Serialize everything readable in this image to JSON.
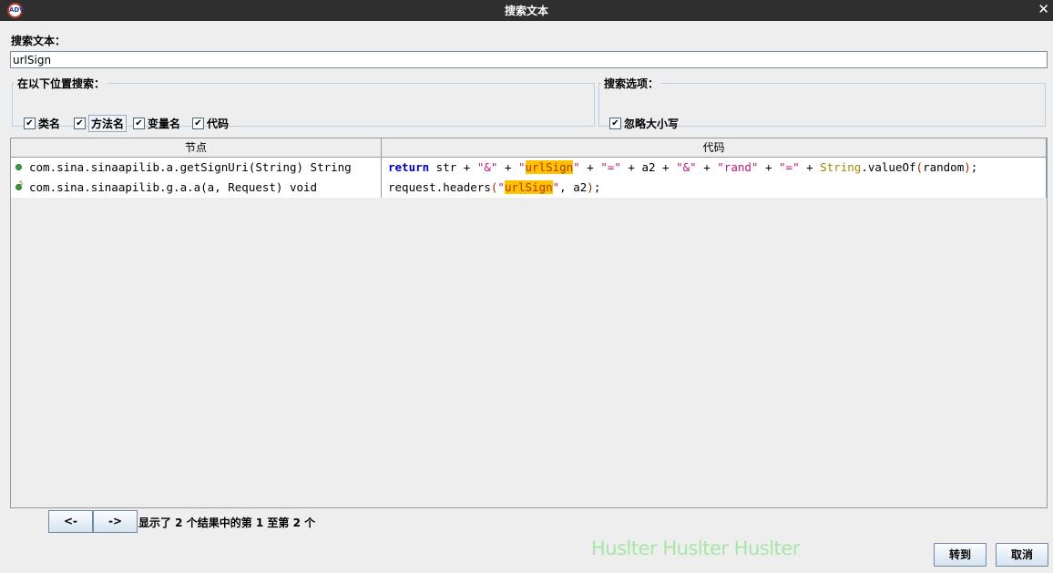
{
  "window": {
    "title": "搜索文本",
    "close_glyph": "✕",
    "icon_text": "ADV"
  },
  "search": {
    "label": "搜索文本：",
    "value": "urlSign"
  },
  "location_group": {
    "legend": "在以下位置搜索：",
    "options": [
      {
        "label": "类名",
        "checked": true
      },
      {
        "label": "方法名",
        "checked": true
      },
      {
        "label": "变量名",
        "checked": true
      },
      {
        "label": "代码",
        "checked": true
      }
    ]
  },
  "options_group": {
    "legend": "搜索选项：",
    "options": [
      {
        "label": "忽略大小写",
        "checked": true
      }
    ]
  },
  "results": {
    "columns": {
      "node": "节点",
      "code": "代码"
    },
    "rows": [
      {
        "node": "com.sina.sinaapilib.a.getSignUri(String) String",
        "icon": "method-public-icon",
        "code_tokens": [
          {
            "t": "return",
            "c": "kw"
          },
          {
            "t": " str + ",
            "c": ""
          },
          {
            "t": "\"&\"",
            "c": "str"
          },
          {
            "t": " + ",
            "c": ""
          },
          {
            "t": "\"",
            "c": "str"
          },
          {
            "t": "urlSign",
            "c": "hl"
          },
          {
            "t": "\"",
            "c": "str"
          },
          {
            "t": " + ",
            "c": ""
          },
          {
            "t": "\"=\"",
            "c": "str"
          },
          {
            "t": " + a2 + ",
            "c": ""
          },
          {
            "t": "\"&\"",
            "c": "str"
          },
          {
            "t": " + ",
            "c": ""
          },
          {
            "t": "\"rand\"",
            "c": "str"
          },
          {
            "t": " + ",
            "c": ""
          },
          {
            "t": "\"=\"",
            "c": "str"
          },
          {
            "t": " + ",
            "c": ""
          },
          {
            "t": "String",
            "c": "ty"
          },
          {
            "t": ".valueOf",
            "c": ""
          },
          {
            "t": "(",
            "c": "par"
          },
          {
            "t": "random",
            "c": ""
          },
          {
            "t": ")",
            "c": "par"
          },
          {
            "t": ";",
            "c": ""
          }
        ]
      },
      {
        "node": "com.sina.sinaapilib.g.a.a(a, Request) void",
        "icon": "method-static-icon",
        "code_tokens": [
          {
            "t": "request.headers",
            "c": ""
          },
          {
            "t": "(",
            "c": "par"
          },
          {
            "t": "\"",
            "c": "str"
          },
          {
            "t": "urlSign",
            "c": "hl"
          },
          {
            "t": "\"",
            "c": "str"
          },
          {
            "t": ", a2",
            "c": ""
          },
          {
            "t": ")",
            "c": "par"
          },
          {
            "t": ";",
            "c": ""
          }
        ]
      }
    ]
  },
  "pager": {
    "prev": "<-",
    "next": "->",
    "status": "显示了 2 个结果中的第 1 至第 2 个"
  },
  "watermark": "Huslter Huslter Huslter",
  "buttons": {
    "goto": "转到",
    "cancel": "取消"
  }
}
